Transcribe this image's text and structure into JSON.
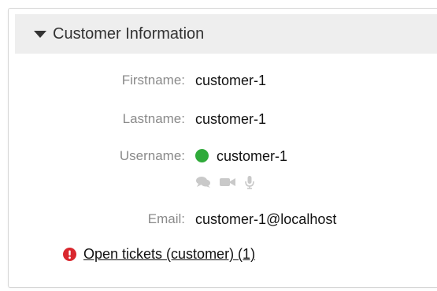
{
  "panel": {
    "title": "Customer Information"
  },
  "fields": {
    "firstname": {
      "label": "Firstname:",
      "value": "customer-1"
    },
    "lastname": {
      "label": "Lastname:",
      "value": "customer-1"
    },
    "username": {
      "label": "Username:",
      "value": "customer-1",
      "status_color": "#2faa3a"
    },
    "email": {
      "label": "Email:",
      "value": "customer-1@localhost"
    }
  },
  "chat_icons": [
    "chat-icon",
    "video-icon",
    "microphone-icon"
  ],
  "open_tickets": {
    "label": "Open tickets (customer) (1)",
    "icon": "alert-icon",
    "icon_color": "#d9272e"
  }
}
